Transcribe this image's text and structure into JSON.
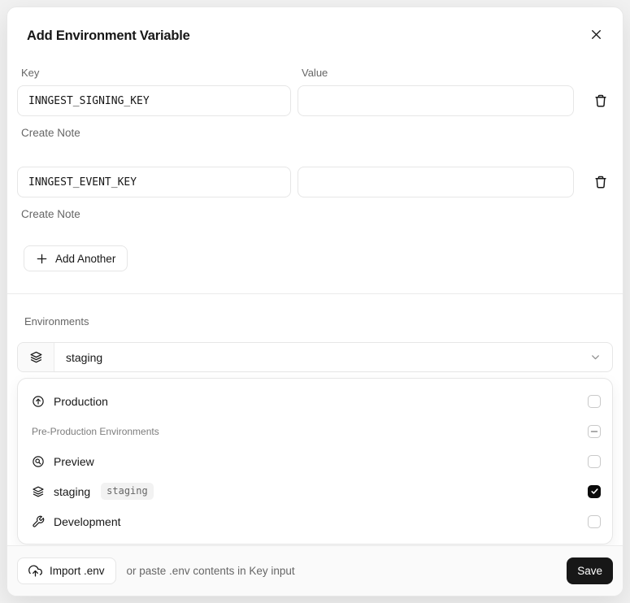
{
  "modal": {
    "title": "Add Environment Variable"
  },
  "form": {
    "key_label": "Key",
    "value_label": "Value",
    "rows": [
      {
        "key": "INNGEST_SIGNING_KEY",
        "value": "",
        "note_label": "Create Note"
      },
      {
        "key": "INNGEST_EVENT_KEY",
        "value": "",
        "note_label": "Create Note"
      }
    ],
    "add_another_label": "Add Another"
  },
  "environments": {
    "label": "Environments",
    "selected_value": "staging",
    "selected_icon": "layers-icon",
    "options": [
      {
        "label": "Production",
        "icon": "arrow-up-circle-icon",
        "state": "unchecked"
      },
      {
        "label": "Pre-Production Environments",
        "type": "group-header",
        "state": "indeterminate"
      },
      {
        "label": "Preview",
        "icon": "magnifier-circle-icon",
        "state": "unchecked"
      },
      {
        "label": "staging",
        "badge": "staging",
        "icon": "layers-icon",
        "state": "checked"
      },
      {
        "label": "Development",
        "icon": "wrench-icon",
        "state": "unchecked"
      }
    ]
  },
  "footer": {
    "import_label": "Import .env",
    "import_icon": "cloud-upload-icon",
    "hint": "or paste .env contents in Key input",
    "save_label": "Save"
  },
  "colors": {
    "accent_button": "#171717",
    "modal_background": "#ffffff",
    "footer_background": "#fafafa",
    "border": "#e6e6e6",
    "muted_text": "#666666",
    "checked_checkbox": "#0a0a0a",
    "badge_background": "#f2f2f2"
  }
}
